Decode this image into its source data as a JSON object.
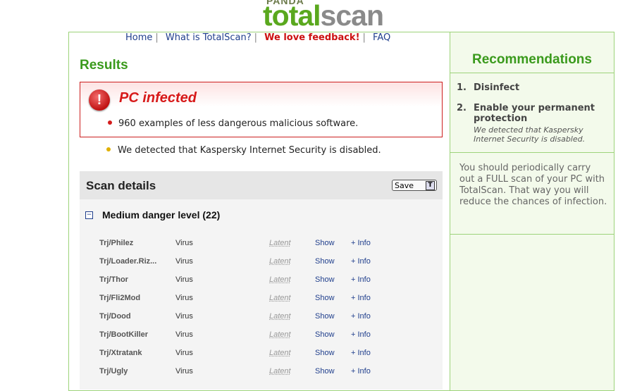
{
  "logo": {
    "brand": "PANDA",
    "word_total": "total",
    "word_scan": "scan"
  },
  "nav": {
    "items": [
      "Home",
      "What is TotalScan?",
      "We love feedback!",
      "FAQ"
    ],
    "separator": "|"
  },
  "results": {
    "title": "Results",
    "infected_title": "PC infected",
    "infected_detail": "960 examples of less dangerous malicious software.",
    "warning": "We detected that Kaspersky Internet Security is disabled."
  },
  "scan": {
    "title": "Scan details",
    "save_label": "Save",
    "save_icon_glyph": "T",
    "danger_group": "Medium danger level (22)",
    "collapse_glyph": "−",
    "rows": [
      {
        "name": "Trj/Philez",
        "type": "Virus",
        "status": "Latent",
        "show": "Show",
        "info": "+ Info"
      },
      {
        "name": "Trj/Loader.Riz...",
        "type": "Virus",
        "status": "Latent",
        "show": "Show",
        "info": "+ Info"
      },
      {
        "name": "Trj/Thor",
        "type": "Virus",
        "status": "Latent",
        "show": "Show",
        "info": "+ Info"
      },
      {
        "name": "Trj/Fli2Mod",
        "type": "Virus",
        "status": "Latent",
        "show": "Show",
        "info": "+ Info"
      },
      {
        "name": "Trj/Dood",
        "type": "Virus",
        "status": "Latent",
        "show": "Show",
        "info": "+ Info"
      },
      {
        "name": "Trj/BootKiller",
        "type": "Virus",
        "status": "Latent",
        "show": "Show",
        "info": "+ Info"
      },
      {
        "name": "Trj/Xtratank",
        "type": "Virus",
        "status": "Latent",
        "show": "Show",
        "info": "+ Info"
      },
      {
        "name": "Trj/Ugly",
        "type": "Virus",
        "status": "Latent",
        "show": "Show",
        "info": "+ Info"
      }
    ]
  },
  "recommendations": {
    "title": "Recommendations",
    "items": [
      {
        "num": "1.",
        "text": "Disinfect"
      },
      {
        "num": "2.",
        "text": "Enable your permanent protection",
        "note": "We detected that Kaspersky Internet Security is disabled."
      }
    ],
    "message": "You should periodically carry out a FULL scan of your PC with TotalScan. That way you will reduce the chances of infection."
  },
  "colors": {
    "accent_green": "#3a9a1c",
    "alert_red": "#d71919",
    "link_blue": "#1f3e8c"
  }
}
